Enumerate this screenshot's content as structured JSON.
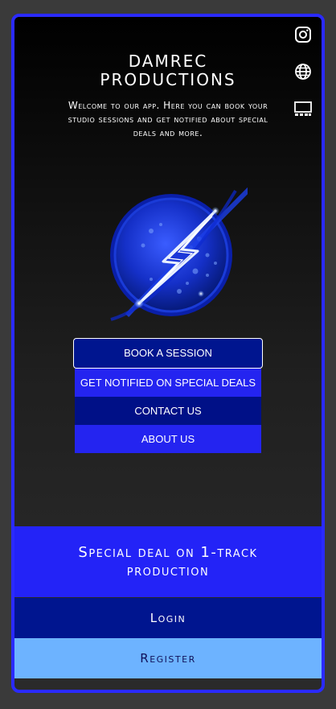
{
  "app": {
    "title_line1": "DAMREC",
    "title_line2": "PRODUCTIONS",
    "welcome": "Welcome to our app. Here you can book your studio sessions and get notified about special deals and more."
  },
  "side_icons": [
    {
      "name": "instagram-icon"
    },
    {
      "name": "globe-icon"
    },
    {
      "name": "gallery-icon"
    }
  ],
  "logo": {
    "icon": "lightning-bolt-globe-logo"
  },
  "menu": {
    "book": "BOOK A SESSION",
    "notify": "GET NOTIFIED ON SPECIAL DEALS",
    "contact": "CONTACT US",
    "about": "ABOUT US"
  },
  "deal": {
    "text": "Special deal on 1-track production"
  },
  "auth": {
    "login": "Login",
    "register": "Register"
  },
  "colors": {
    "accent": "#2323f7",
    "navy": "#00158f",
    "light_blue": "#6db3ff",
    "frame": "#2a2aff"
  }
}
